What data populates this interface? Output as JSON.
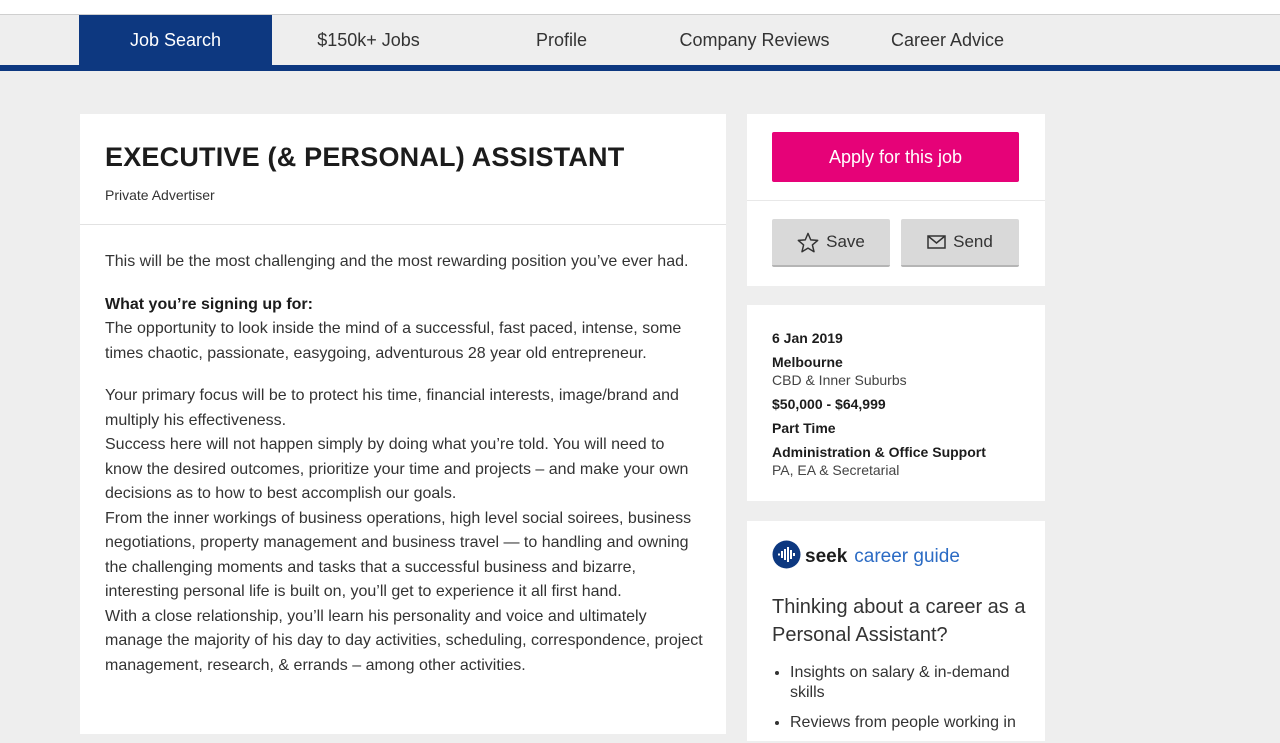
{
  "nav": {
    "tabs": [
      {
        "label": "Job Search",
        "active": true
      },
      {
        "label": "$150k+ Jobs",
        "active": false
      },
      {
        "label": "Profile",
        "active": false
      },
      {
        "label": "Company Reviews",
        "active": false
      },
      {
        "label": "Career Advice",
        "active": false
      }
    ]
  },
  "colors": {
    "brand_navy": "#0d3880",
    "apply_pink": "#e60278",
    "guide_blue": "#2b6bc4"
  },
  "job": {
    "title": "EXECUTIVE (& PERSONAL) ASSISTANT",
    "advertiser": "Private Advertiser",
    "intro": "This will be the most challenging and the most rewarding position you’ve ever had.",
    "subheading": "What you’re signing up for:",
    "opportunity": "The opportunity to look inside the mind of a successful, fast paced, intense, some times chaotic, passionate, easygoing, adventurous 28 year old entrepreneur.",
    "focus": "Your primary focus will be to protect his time, financial interests, image/brand and multiply his effectiveness.",
    "success": "Success here will not happen simply by doing what you’re told.  You will need to know the desired outcomes, prioritize your time and projects – and make your own decisions as to how to best accomplish our goals.",
    "workings": "From the inner workings of business operations, high level social soirees, business negotiations, property management and business travel — to handling and owning the challenging moments and tasks that a successful business and bizarre, interesting personal life is built on, you’ll get to experience it all first hand.",
    "relationship": "With a close relationship, you’ll learn his personality and voice and ultimately manage the majority of his day to day activities, scheduling, correspondence, project management, research, & errands – among other activities."
  },
  "actions": {
    "apply_label": "Apply for this job",
    "save_label": "Save",
    "send_label": "Send"
  },
  "details": {
    "date": "6 Jan 2019",
    "location": "Melbourne",
    "area": "CBD & Inner Suburbs",
    "salary": "$50,000 - $64,999",
    "work_type": "Part Time",
    "classification": "Administration & Office Support",
    "subclassification": "PA, EA & Secretarial"
  },
  "career_guide": {
    "brand": "seek",
    "brand_suffix": "career guide",
    "heading": "Thinking about a career as a Personal Assistant?",
    "bullets": [
      "Insights on salary & in-demand skills",
      "Reviews from people working in"
    ]
  }
}
